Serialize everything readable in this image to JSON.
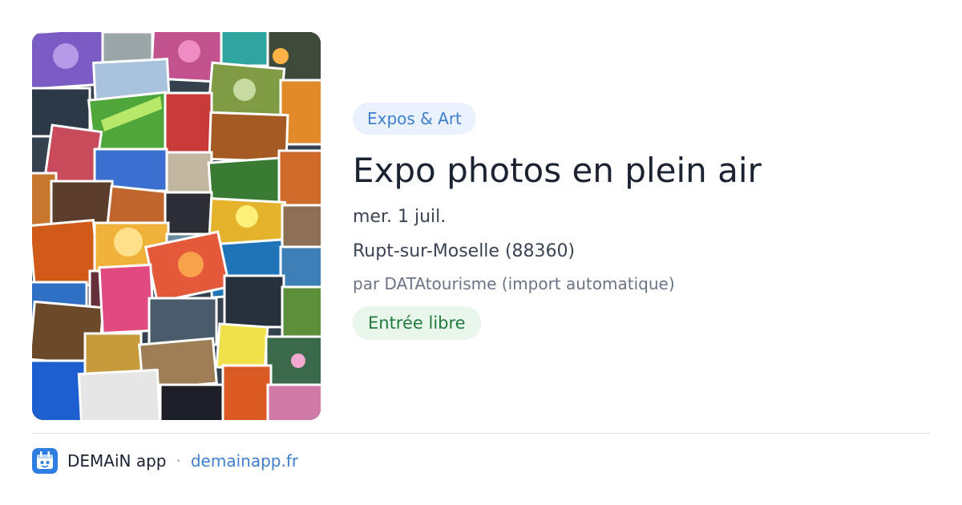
{
  "event": {
    "photo_alt": "Collage de photos",
    "category": "Expos & Art",
    "title": "Expo photos en plein air",
    "date": "mer. 1 juil.",
    "location": "Rupt-sur-Moselle (88360)",
    "author": "par DATAtourisme (import automatique)",
    "price": "Entrée libre"
  },
  "footer": {
    "logo_icon": "demain-app-logo-icon",
    "app_name": "DEMAiN app",
    "separator": "·",
    "site": "demainapp.fr"
  },
  "colors": {
    "category_bg": "#eaf2fd",
    "category_text": "#3f7fd0",
    "price_bg": "#e8f6ec",
    "price_text": "#237a3d",
    "title_text": "#1b2333",
    "link": "#3f7fd0"
  }
}
